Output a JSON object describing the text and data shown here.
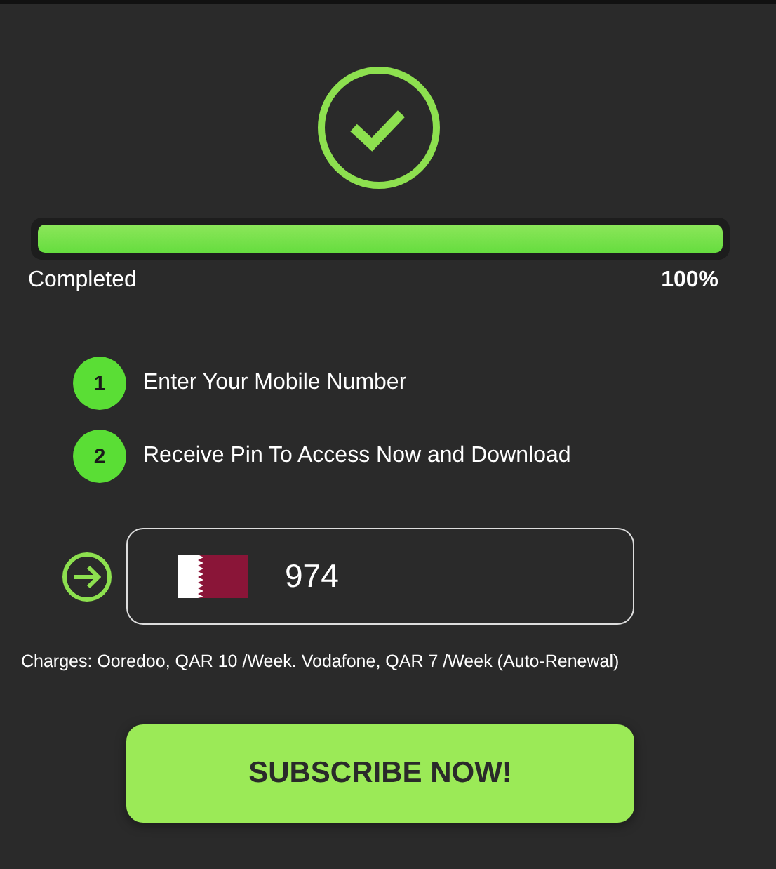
{
  "progress": {
    "level": 1,
    "label": "Completed",
    "percent": "100%"
  },
  "steps": [
    {
      "number": "1",
      "text": "Enter Your Mobile Number"
    },
    {
      "number": "2",
      "text": "Receive Pin To Access Now and Download"
    }
  ],
  "phone": {
    "value": "974"
  },
  "charges": "Charges: Ooredoo, QAR 10 /Week. Vodafone, QAR 7 /Week (Auto-Renewal)",
  "button": "SUBSCRIBE NOW!"
}
